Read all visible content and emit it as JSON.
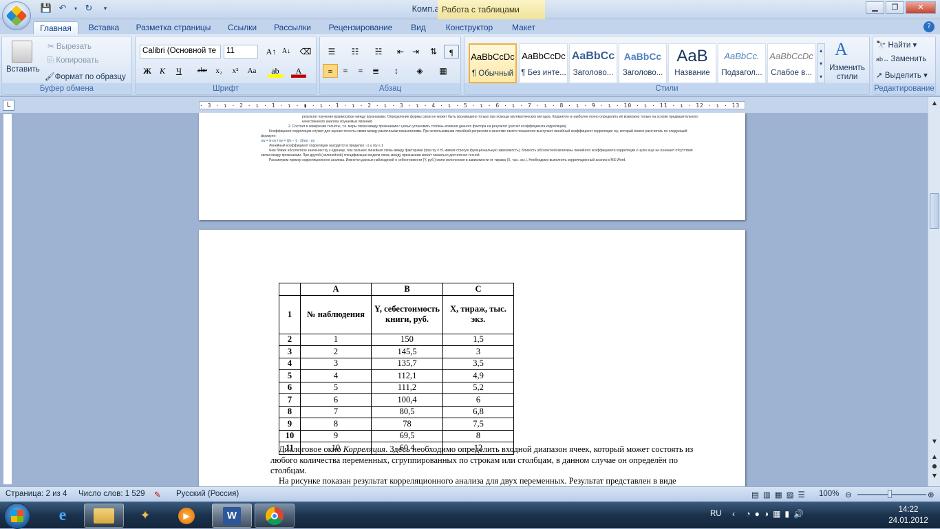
{
  "window": {
    "title": "Комп.анализ - Microsoft Word",
    "contextual_tab": "Работа с таблицами"
  },
  "tabs": [
    "Главная",
    "Вставка",
    "Разметка страницы",
    "Ссылки",
    "Рассылки",
    "Рецензирование",
    "Вид",
    "Конструктор",
    "Макет"
  ],
  "clipboard": {
    "paste": "Вставить",
    "cut": "Вырезать",
    "copy": "Копировать",
    "format_painter": "Формат по образцу",
    "label": "Буфер обмена"
  },
  "font": {
    "name": "Calibri (Основной те",
    "size": "11",
    "label": "Шрифт"
  },
  "paragraph": {
    "label": "Абзац"
  },
  "styles": {
    "label": "Стили",
    "change": "Изменить стили",
    "items": [
      {
        "preview": "AaBbCcDc",
        "name": "¶ Обычный"
      },
      {
        "preview": "AaBbCcDc",
        "name": "¶ Без инте..."
      },
      {
        "preview": "AaBbCc",
        "name": "Заголово..."
      },
      {
        "preview": "AaBbCc",
        "name": "Заголово..."
      },
      {
        "preview": "AaB",
        "name": "Название"
      },
      {
        "preview": "AaBbCc.",
        "name": "Подзагол..."
      },
      {
        "preview": "AaBbCcDc",
        "name": "Слабое в..."
      }
    ]
  },
  "editing": {
    "find": "Найти",
    "replace": "Заменить",
    "select": "Выделить",
    "label": "Редактирование"
  },
  "ruler_text": "· 3 · ı · 2 · ı · 1 · ı · ▮ · ı · 1 · ı · 2 · ı · 3 · ı · 4 · ı · 5 · ı · 6 · ı · 7 · ı · 8 · ı · 9 · ı · 10 · ı · 11 · ı · 12 · ı · 13 · ı · 14 · ı · 15 · ı · 16 · ı · 17 · ı ·",
  "page1_text": [
    "результат изучения взаимосвязи между признаками. Определение формы связи не может быть произведено только при помощи математических методов. Корректно и наиболее полно определить её возможно только на основе предварительного качественного анализа изучаемых явлений.",
    "2. Состоит в измерении тесноты, т.е. меры связи между признаками с целью установить степень влияния данного фактора на результат (расчёт коэффициента корреляции).",
    "Коэффициент корреляции служит для оценки тесноты связи между различными показателями. При использовании линейной регрессии в качестве такого показателя выступает линейный коэффициент корреляции rxy, который можно рассчитать по следующей формуле:",
    "rxy = b·σx / σy = (ȳx − ȳ · x̄)/σx · σy",
    "Линейный коэффициент корреляции находится в пределах: -1 ≤ rxy ≤ 1",
    "Чем ближе абсолютное значение rxy к единице, тем сильнее линейная связь между факторами (при rxy = ±1 имеем строгую функциональную зависимость). Близость абсолютной величины линейного коэффициента корреляции к нулю ещё не означает отсутствия связи между признаками. При другой (нелинейной) спецификации модели связь между признаками может оказаться достаточно тесной.",
    "Рассмотрим пример корреляционного анализа. Имеются данные наблюдений о себестоимости (Y, руб.) книги исполнения в зависимости от тиража (X, тыс. экз.). Необходимо выполнить корреляционный анализ в MS Word."
  ],
  "table": {
    "cols": [
      "A",
      "B",
      "C"
    ],
    "header": {
      "num": "1",
      "a": "№ наблюдения",
      "b": "Y, себестоимость книги, руб.",
      "c": "X, тираж, тыс. экз."
    },
    "rows": [
      [
        "2",
        "1",
        "150",
        "1,5"
      ],
      [
        "3",
        "2",
        "145,5",
        "3"
      ],
      [
        "4",
        "3",
        "135,7",
        "3,5"
      ],
      [
        "5",
        "4",
        "112,1",
        "4,9"
      ],
      [
        "6",
        "5",
        "111,2",
        "5,2"
      ],
      [
        "7",
        "6",
        "100,4",
        "6"
      ],
      [
        "8",
        "7",
        "80,5",
        "6,8"
      ],
      [
        "9",
        "8",
        "78",
        "7,5"
      ],
      [
        "10",
        "9",
        "69,5",
        "8"
      ],
      [
        "11",
        "10",
        "60,4",
        "12"
      ]
    ]
  },
  "para1": {
    "pre": "Диалоговое окно ",
    "em": "Корреляция",
    "post": ". Здесь необходимо определить входной диапазон ячеек, который может состоять из любого количества переменных, сгруппированных по строкам или столбцам, в данном случае он определён по столбцам."
  },
  "para2": "На рисунке показан результат корреляционного анализа для двух переменных. Результат представлен в виде",
  "status": {
    "page": "Страница: 2 из 4",
    "words": "Число слов: 1 529",
    "lang": "Русский (Россия)",
    "zoom": "100%"
  },
  "taskbar": {
    "lang": "RU",
    "time": "14:22",
    "date": "24.01.2012"
  },
  "colors": {
    "accent": "#2b579a",
    "ribbon": "#d2e0f3"
  }
}
